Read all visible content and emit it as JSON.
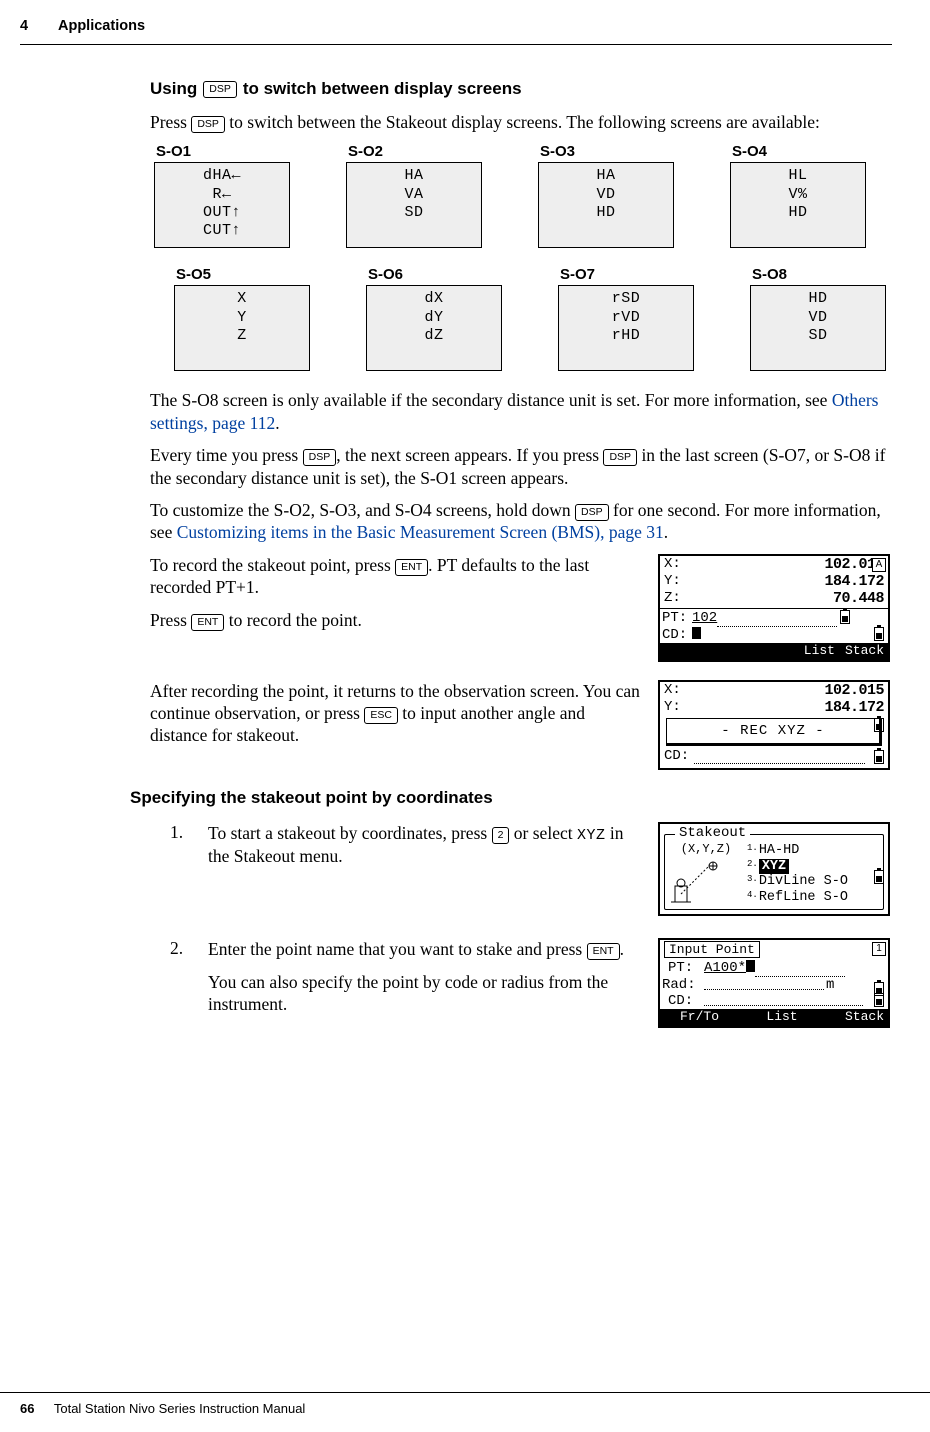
{
  "header": {
    "chapter_num": "4",
    "chapter_title": "Applications"
  },
  "footer": {
    "page_num": "66",
    "manual_title": "Total Station Nivo Series Instruction Manual"
  },
  "section1": {
    "heading_pre": "Using ",
    "heading_key": "DSP",
    "heading_post": " to switch between display screens",
    "p1_a": "Press ",
    "p1_key": "DSP",
    "p1_b": " to switch between the Stakeout display screens. The following screens are available:"
  },
  "screens": {
    "row1": [
      {
        "label": "S-O1",
        "lines": [
          "dHA←",
          "R←",
          "OUT↑",
          "CUT↑"
        ]
      },
      {
        "label": "S-O2",
        "lines": [
          "HA",
          "VA",
          "SD"
        ]
      },
      {
        "label": "S-O3",
        "lines": [
          "HA",
          "VD",
          "HD"
        ]
      },
      {
        "label": "S-O4",
        "lines": [
          "HL",
          "V%",
          "HD"
        ]
      }
    ],
    "row2": [
      {
        "label": "S-O5",
        "lines": [
          "X",
          "Y",
          "Z"
        ]
      },
      {
        "label": "S-O6",
        "lines": [
          "dX",
          "dY",
          "dZ"
        ]
      },
      {
        "label": "S-O7",
        "lines": [
          "rSD",
          "rVD",
          "rHD"
        ]
      },
      {
        "label": "S-O8",
        "lines": [
          "HD",
          "VD",
          "SD"
        ]
      }
    ]
  },
  "body": {
    "p_so8_a": "The S-O8 screen is only available if the secondary distance unit is set. For more information, see ",
    "p_so8_link": "Others settings, page 112",
    "p_so8_b": ".",
    "p_every_a": "Every time you press ",
    "p_every_key1": "DSP",
    "p_every_b": ", the next screen appears. If you press ",
    "p_every_key2": "DSP",
    "p_every_c": " in the last screen (S-O7, or S-O8 if the secondary distance unit is set), the S-O1 screen appears.",
    "p_custom_a": "To customize the S-O2, S-O3, and S-O4 screens, hold down ",
    "p_custom_key": "DSP",
    "p_custom_b": " for one second. For more information, see ",
    "p_custom_link": "Customizing items in the Basic Measurement Screen (BMS), page 31",
    "p_custom_c": ".",
    "p_record_a": "To record the stakeout point, press ",
    "p_record_key": "ENT",
    "p_record_b": ". PT defaults to the last recorded PT+1.",
    "p_press_a": "Press ",
    "p_press_key": "ENT",
    "p_press_b": " to record the point.",
    "p_after_a": "After recording the point, it returns to the observation screen. You can continue observation, or press ",
    "p_after_key": "ESC",
    "p_after_b": " to input another angle and distance for stakeout."
  },
  "lcd1": {
    "x_l": "X:",
    "x_v": "102.015",
    "y_l": "Y:",
    "y_v": "184.172",
    "z_l": "Z:",
    "z_v": "70.448",
    "pt_l": "PT:",
    "pt_v": "102",
    "cd_l": "CD:",
    "soft1": "List",
    "soft2": "Stack",
    "badge": "A"
  },
  "lcd2": {
    "x_l": "X:",
    "x_v": "102.015",
    "y_l": "Y:",
    "y_v": "184.172",
    "banner": "- REC XYZ -",
    "cd_l": "CD:"
  },
  "section2": {
    "heading": "Specifying the stakeout point by coordinates",
    "step1_a": "To start a stakeout by coordinates, press ",
    "step1_key": "2",
    "step1_b": " or select ",
    "step1_mono": "XYZ",
    "step1_c": " in the Stakeout menu.",
    "step2_a": "Enter the point name that you want to stake and press ",
    "step2_key": "ENT",
    "step2_b": ".",
    "step2_p2": "You can also specify the point by code or radius from the instrument.",
    "num1": "1.",
    "num2": "2."
  },
  "menu_lcd": {
    "title": "Stakeout",
    "xyz_label": "(X,Y,Z)",
    "items": [
      {
        "n": "1.",
        "t": "HA-HD"
      },
      {
        "n": "2.",
        "t": "XYZ"
      },
      {
        "n": "3.",
        "t": "DivLine S-O"
      },
      {
        "n": "4.",
        "t": "RefLine S-O"
      }
    ]
  },
  "input_lcd": {
    "title": "Input Point",
    "pt_l": "PT:",
    "pt_v": "A100*",
    "rad_l": "Rad:",
    "rad_unit": "m",
    "cd_l": "CD:",
    "soft1": "Fr/To",
    "soft2": "List",
    "soft3": "Stack",
    "badge": "1"
  }
}
